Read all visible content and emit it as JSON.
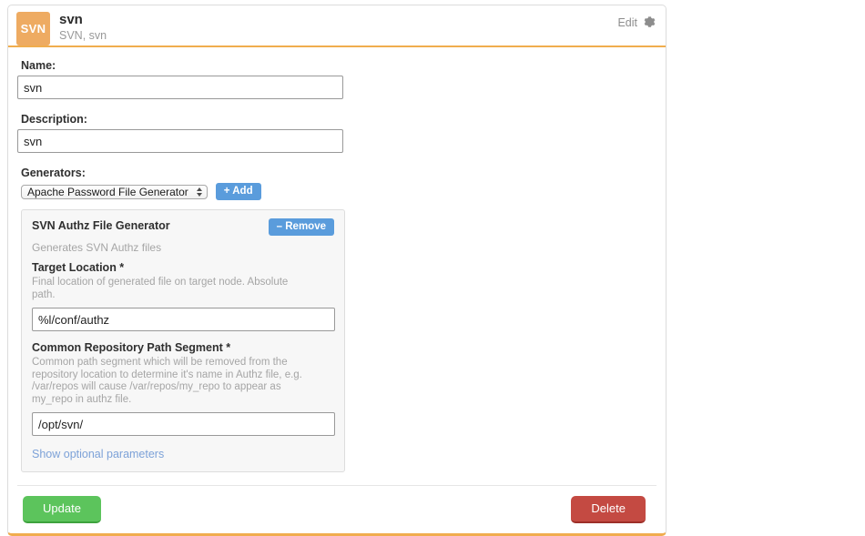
{
  "header": {
    "avatar_label": "SVN",
    "title": "svn",
    "subtitle": "SVN, svn",
    "edit_label": "Edit",
    "gear_icon": "gear-icon"
  },
  "form": {
    "name_label": "Name:",
    "name_value": "svn",
    "name_placeholder": "",
    "description_label": "Description:",
    "description_value": "svn",
    "description_placeholder": "",
    "generators_label": "Generators:",
    "generator_select_value": "Apache Password File Generator",
    "generator_select_options": [
      "Apache Password File Generator"
    ],
    "add_button_label": "+ Add"
  },
  "generator_panel": {
    "title": "SVN Authz File Generator",
    "remove_button_label": "– Remove",
    "description": "Generates SVN Authz files",
    "params": [
      {
        "label": "Target Location *",
        "help": "Final location of generated file on target node. Absolute path.",
        "value": "%l/conf/authz",
        "placeholder": ""
      },
      {
        "label": "Common Repository Path Segment *",
        "help": "Common path segment which will be removed from the repository location to determine it's name in Authz file, e.g. /var/repos will cause /var/repos/my_repo to appear as my_repo in authz file.",
        "value": "/opt/svn/",
        "placeholder": ""
      }
    ],
    "optional_link_label": "Show optional parameters"
  },
  "footer": {
    "update_button_label": "Update",
    "delete_button_label": "Delete"
  },
  "colors": {
    "accent_orange": "#f0ad4e",
    "avatar_orange": "#eeab62",
    "button_blue": "#5a9cdc",
    "button_green": "#5cc45c",
    "button_red": "#c44a42",
    "link_blue": "#7da2d8"
  }
}
